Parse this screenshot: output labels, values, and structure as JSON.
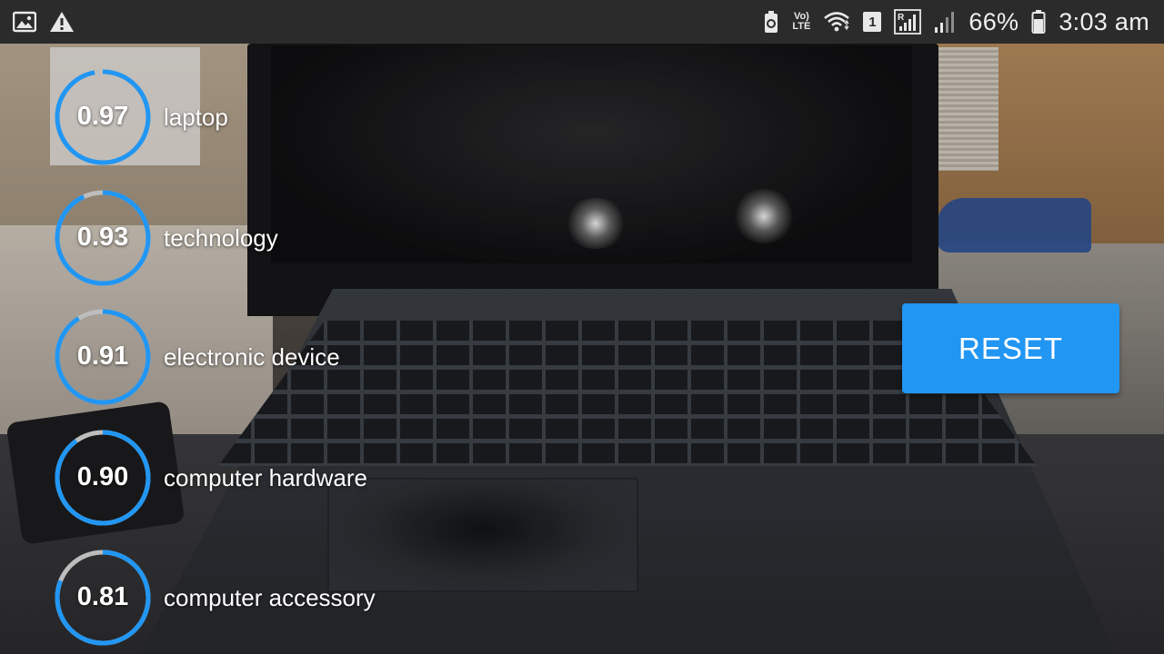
{
  "status_bar": {
    "left_icons": [
      "image-icon",
      "warning-icon"
    ],
    "right_icons": [
      "battery-saver-icon",
      "volte-icon",
      "wifi-icon",
      "sim-slot-icon",
      "roaming-signal-icon",
      "cellular-signal-icon",
      "battery-icon"
    ],
    "volte_top": "Vo)",
    "volte_bottom": "LTE",
    "sim_slot": "1",
    "battery_percent": "66%",
    "time": "3:03 am"
  },
  "predictions": [
    {
      "score": "0.97",
      "confidence": 0.97,
      "label": "laptop"
    },
    {
      "score": "0.93",
      "confidence": 0.93,
      "label": "technology"
    },
    {
      "score": "0.91",
      "confidence": 0.91,
      "label": "electronic device"
    },
    {
      "score": "0.90",
      "confidence": 0.9,
      "label": "computer hardware"
    },
    {
      "score": "0.81",
      "confidence": 0.81,
      "label": "computer accessory"
    }
  ],
  "reset_button": {
    "label": "RESET"
  },
  "colors": {
    "accent": "#2196f3",
    "ring_track": "#bdbdbd",
    "status_bar_bg": "#2b2b2b"
  }
}
